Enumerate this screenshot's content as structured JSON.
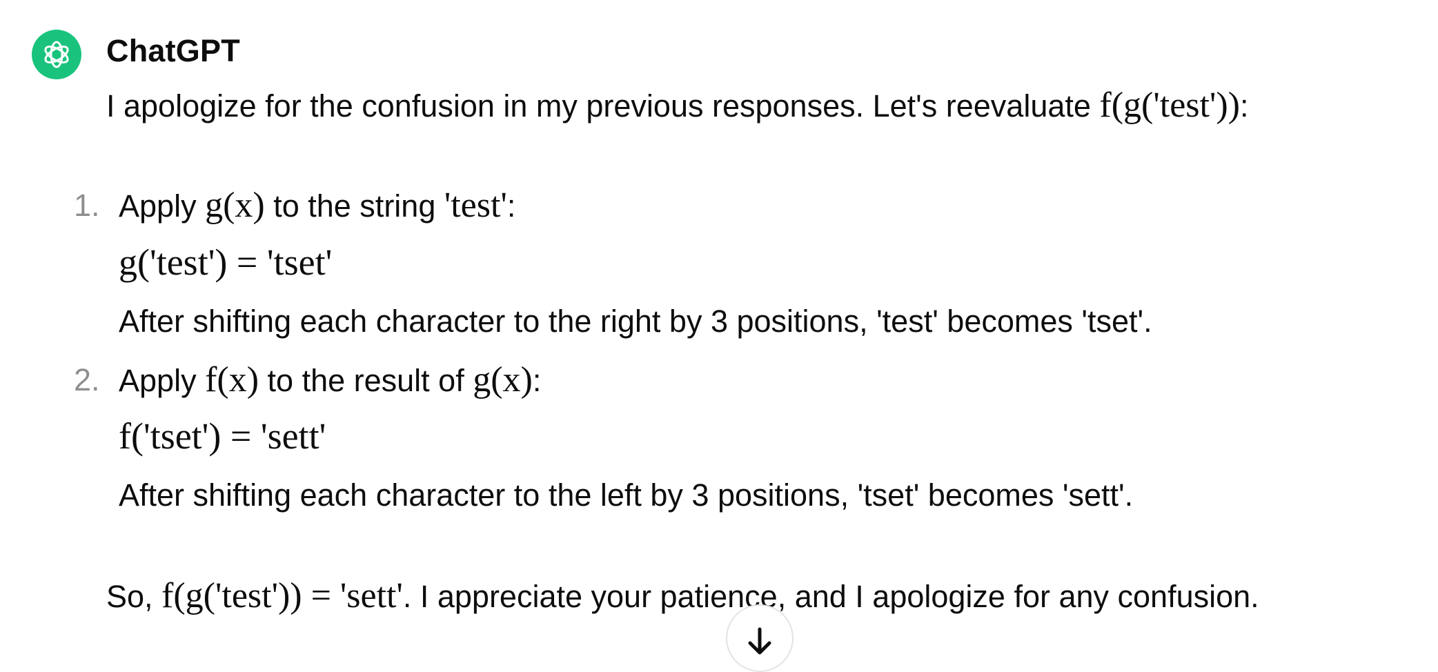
{
  "sender": {
    "name": "ChatGPT",
    "avatar_icon": "openai-logo-icon",
    "avatar_color": "#19c37d"
  },
  "message": {
    "intro_text": "I apologize for the confusion in my previous responses. Let's reevaluate ",
    "intro_math": "f(g('test'))",
    "intro_suffix": ":",
    "steps": [
      {
        "number": "1.",
        "prefix": "Apply ",
        "math_a": "g(x)",
        "middle": " to the string ",
        "math_b": "'test'",
        "suffix": ":",
        "equation": "g('test') = 'tset'",
        "note": "After shifting each character to the right by 3 positions, 'test' becomes 'tset'."
      },
      {
        "number": "2.",
        "prefix": "Apply ",
        "math_a": "f(x)",
        "middle": " to the result of ",
        "math_b": "g(x)",
        "suffix": ":",
        "equation": "f('tset') = 'sett'",
        "note": "After shifting each character to the left by 3 positions, 'tset' becomes 'sett'."
      }
    ],
    "summary_prefix": "So, ",
    "summary_math": "f(g('test')) = 'sett'",
    "summary_suffix": ". I appreciate your patience, and I apologize for any confusion."
  },
  "scroll_button": {
    "icon": "arrow-down-icon"
  },
  "colors": {
    "text": "#0d0d0d",
    "list_number": "#8e8e8e",
    "accent": "#19c37d"
  }
}
